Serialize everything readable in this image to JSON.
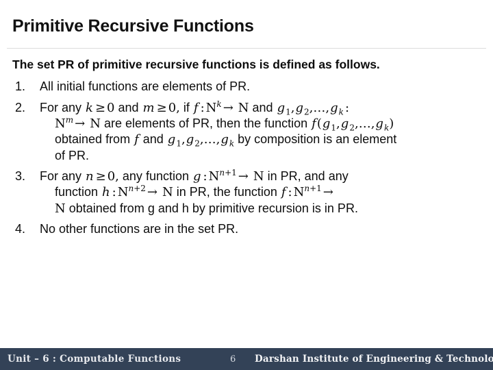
{
  "slide": {
    "title": "Primitive Recursive Functions",
    "lead": "The set PR of primitive recursive functions is defined as follows.",
    "items": [
      {
        "number": "1.",
        "text": "All initial functions are elements of PR."
      },
      {
        "number": "2.",
        "text": "For any k ≥ 0 and m ≥ 0, if f : N^k → N and g_1, g_2, … , g_k : N^m → N are elements of PR, then the function f(g_1, g_2, … , g_k) obtained from f and g_1, g_2, … , g_k by composition is an element of PR.",
        "parts": {
          "p1": "For any",
          "var_k": "k",
          "ge1": "≥",
          "zero1": "0",
          "and1": "and",
          "var_m": "m",
          "ge2": "≥",
          "zero2": "0,",
          "if": "if",
          "var_f": "f",
          "colon1": ":",
          "N1": "N",
          "sup_k": "k",
          "arrow1": "→",
          "N2": "N",
          "and2": "and",
          "g": "g",
          "one": "1",
          "two": "2",
          "ellipsis": "…",
          "sub_k": "k",
          "colon2": ":",
          "N3": "N",
          "sup_m": "m",
          "arrow2": "→",
          "N4": "N",
          "p2": "are elements of PR, then the function",
          "p3": "obtained from",
          "p4": "and",
          "p5": "by composition is an element",
          "p6": "of PR."
        }
      },
      {
        "number": "3.",
        "text": "For any n ≥ 0, any function g : N^(n+1) → N in PR, and any function h : N^(n+2) → N in PR, the function f : N^(n+1) → N obtained from g and h by primitive recursion is in PR.",
        "parts": {
          "p1": "For any",
          "var_n": "n",
          "ge": "≥",
          "zero": "0,",
          "p2": "any",
          "p3": "function",
          "var_g": "g",
          "colon1": ":",
          "N1": "N",
          "sup_n1": "n",
          "plus1": "+",
          "one1": "1",
          "arrow1": "→",
          "N2": "N",
          "p4": "in",
          "p5": "PR,",
          "p6": "and",
          "p7": "any",
          "p8": "function",
          "var_h": "h",
          "colon2": ":",
          "N3": "N",
          "sup_n2": "n",
          "plus2": "+",
          "two2": "2",
          "arrow2": "→",
          "N4": "N",
          "p9": "in",
          "p10": "PR,",
          "p11": "the",
          "p12": "function",
          "var_f": "f",
          "colon3": ":",
          "N5": "N",
          "sup_n3": "n",
          "plus3": "+",
          "one3": "1",
          "arrow3": "→",
          "N6": "N",
          "p13": "obtained from g and h by primitive recursion is in PR."
        }
      },
      {
        "number": "4.",
        "text": "No other functions are in the set PR."
      }
    ]
  },
  "footer": {
    "unit_label": "Unit – 6 : Computable Functions",
    "page_number": "6",
    "institute": "Darshan Institute of Engineering & Technology",
    "background_color": "#334257",
    "text_color": "#f2f3f5"
  }
}
